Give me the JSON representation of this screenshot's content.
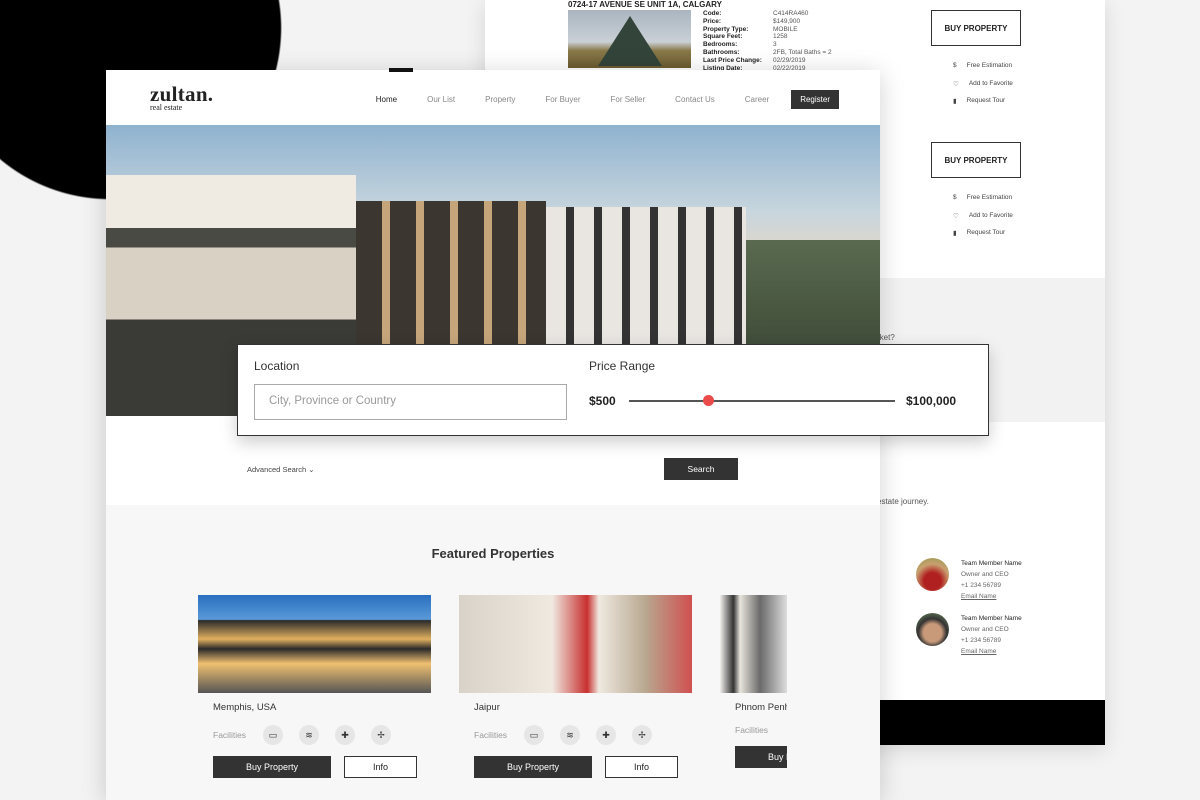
{
  "back": {
    "address": "0724-17 AVENUE SE UNIT 1A, CALGARY",
    "specs": [
      [
        "Code:",
        "C414RA460"
      ],
      [
        "Price:",
        "$149,900"
      ],
      [
        "Property Type:",
        "MOBILE"
      ],
      [
        "Square Feet:",
        "1258"
      ],
      [
        "Bedrooms:",
        "3"
      ],
      [
        "Bathrooms:",
        "2FB, Total Baths = 2"
      ],
      [
        "Last Price Change:",
        "02/29/2019"
      ],
      [
        "Listing Date:",
        "02/22/2019"
      ]
    ],
    "buy_label": "BUY PROPERTY",
    "actions": [
      {
        "icon": "$",
        "label": "Free Estimation"
      },
      {
        "icon": "♡",
        "label": "Add to Favorite"
      },
      {
        "icon": "▮",
        "label": "Request Tour"
      }
    ],
    "question": "rket?",
    "journey": "estate journey.",
    "team": [
      {
        "name": "Team Member Name",
        "role": "Owner and CEO",
        "phone": "+1 234 56789",
        "email": "Email Name"
      },
      {
        "name": "Team Member Name",
        "role": "Owner and CEO",
        "phone": "+1 234 56789",
        "email": "Email Name"
      }
    ]
  },
  "header": {
    "logo": "zultan.",
    "logo_sub": "real estate",
    "nav": [
      "Home",
      "Our List",
      "Property",
      "For Buyer",
      "For Seller",
      "Contact Us",
      "Career"
    ],
    "register": "Register"
  },
  "search": {
    "location_label": "Location",
    "location_placeholder": "City, Province or Country",
    "price_label": "Price Range",
    "price_min": "$500",
    "price_max": "$100,000",
    "slider_fraction": 0.3,
    "advanced": "Advanced Search ⌄",
    "search_button": "Search"
  },
  "featured": {
    "title": "Featured Properties",
    "facilities_label": "Facilities",
    "buy_label": "Buy Property",
    "info_label": "Info",
    "cards": [
      {
        "name": "Memphis, USA"
      },
      {
        "name": "Jaipur"
      },
      {
        "name": "Phnom Penh"
      }
    ]
  },
  "colors": {
    "accent": "#ea4a4a",
    "dark": "#333333"
  }
}
